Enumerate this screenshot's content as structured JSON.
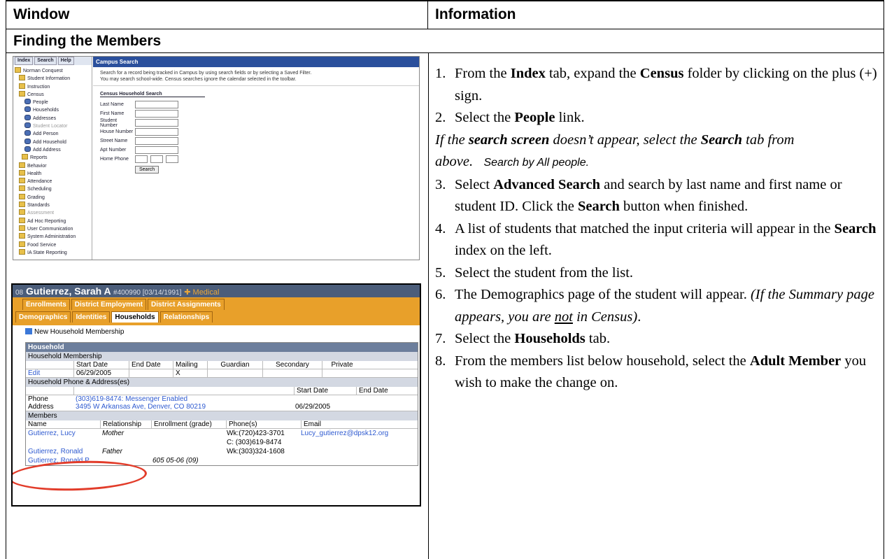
{
  "headers": {
    "window": "Window",
    "information": "Information"
  },
  "section_title": "Finding the Members",
  "shot1": {
    "tabs": [
      "Index",
      "Search",
      "Help"
    ],
    "tree": [
      "Norman Conquest",
      "Student Information",
      "Instruction",
      "Census",
      "People",
      "Households",
      "Addresses",
      "Student Locator",
      "Add Person",
      "Add Household",
      "Add Address",
      "Reports",
      "Behavior",
      "Health",
      "Attendance",
      "Scheduling",
      "Grading",
      "Standards",
      "Assessment",
      "Ad Hoc Reporting",
      "User Communication",
      "System Administration",
      "Food Service",
      "IA State Reporting"
    ],
    "title": "Campus Search",
    "desc1": "Search for a record being tracked in Campus by using search fields or by selecting a Saved Filter.",
    "desc2": "You may search school-wide. Census searches ignore the calendar selected in the toolbar.",
    "form_title": "Census Household Search",
    "fields": [
      "Last Name",
      "First Name",
      "Student Number",
      "House Number",
      "Street Name",
      "Apt Number"
    ],
    "phone_label": "Home Phone",
    "search_button": "Search"
  },
  "shot2": {
    "title_prefix": "08",
    "student": "Gutierrez, Sarah A",
    "student_meta": "#400990 [03/14/1991]",
    "medical": "Medical",
    "tabs_row1": [
      "Enrollments",
      "District Employment",
      "District Assignments"
    ],
    "tabs_row2": [
      "Demographics",
      "Identities",
      "Households",
      "Relationships"
    ],
    "new_household": "New Household Membership",
    "household_band": "Household",
    "membership_sub": "Household Membership",
    "membership_headers": [
      "",
      "Start Date",
      "End Date",
      "Mailing",
      "Guardian",
      "Secondary",
      "Private"
    ],
    "membership_row": [
      "Edit",
      "06/29/2005",
      "",
      "X",
      "",
      "",
      ""
    ],
    "phone_address_sub": "Household Phone & Address(es)",
    "pa_headers": [
      "",
      "",
      "Start Date",
      "End Date"
    ],
    "phone_label": "Phone",
    "phone_value": "(303)619-8474: Messenger Enabled",
    "address_label": "Address",
    "address_value": "3495 W Arkansas Ave, Denver, CO 80219",
    "address_start": "06/29/2005",
    "members_sub": "Members",
    "members_headers": [
      "Name",
      "Relationship",
      "Enrollment (grade)",
      "Phone(s)",
      "Email"
    ],
    "members": [
      {
        "name": "Gutierrez, Lucy",
        "relationship": "Mother",
        "enrollment": "",
        "phone": "Wk:(720)423-3701",
        "email": "Lucy_gutierrez@dpsk12.org"
      },
      {
        "name": "",
        "relationship": "",
        "enrollment": "",
        "phone": "C: (303)619-8474",
        "email": ""
      },
      {
        "name": "Gutierrez, Ronald",
        "relationship": "Father",
        "enrollment": "",
        "phone": "Wk:(303)324-1608",
        "email": ""
      },
      {
        "name": "Gutierrez, Ronald P",
        "relationship": "",
        "enrollment": "605 05-06 (09)",
        "phone": "",
        "email": ""
      }
    ]
  },
  "instructions": {
    "s1": {
      "n": "1.",
      "a": "From the ",
      "b1": "Index",
      "c": " tab, expand the ",
      "b2": "Census",
      "d": " folder by clicking on the plus (+) sign."
    },
    "s2": {
      "n": "2.",
      "a": "Select the ",
      "b1": "People",
      "c": " link."
    },
    "note": {
      "a": "If the ",
      "b1": "search screen",
      "c": " doesn’t appear, select the ",
      "b2": "Search",
      "d": " tab from above.",
      "e": "Search by All people."
    },
    "s3": {
      "n": "3.",
      "a": "Select ",
      "b1": "Advanced Search",
      "c": " and search by last name and first name or student ID.  Click the ",
      "b2": "Search",
      "d": " button when finished."
    },
    "s4": {
      "n": "4.",
      "a": "A list of students that matched the input criteria will appear in the ",
      "b1": "Search",
      "c": " index on the left."
    },
    "s5": {
      "n": "5.",
      "a": "Select the student from the list."
    },
    "s6": {
      "n": "6.",
      "a": "The Demographics page of the student will appear. ",
      "i1": "(If the Summary page appears, you are ",
      "u1": "not",
      "i2": " in Census)",
      "d": "."
    },
    "s7": {
      "n": "7.",
      "a": "Select the ",
      "b1": "Households",
      "c": " tab."
    },
    "s8": {
      "n": "8.",
      "a": "From the members list below household, select the ",
      "b1": "Adult Member",
      "c": " you wish to make the change on."
    }
  }
}
